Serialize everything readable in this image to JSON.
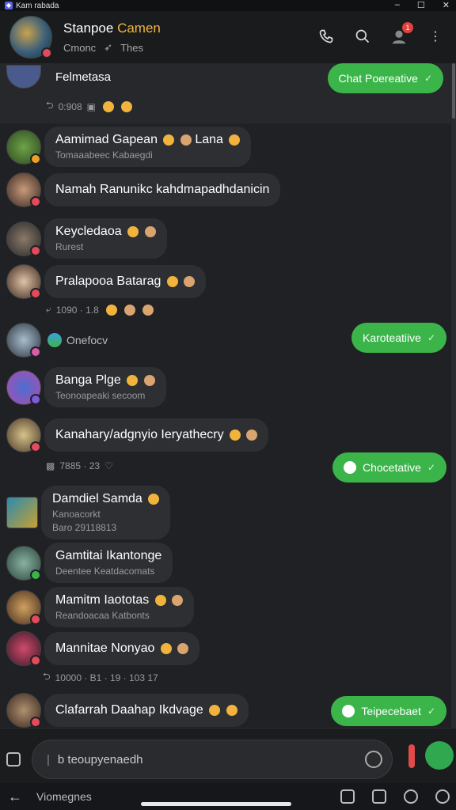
{
  "window": {
    "title": "Kam rabada",
    "controls": [
      "–",
      "☐",
      "✕"
    ]
  },
  "header": {
    "name": "Stanpoe",
    "name_accent": "Camen",
    "subtitle_left": "Cmonc",
    "subtitle_right": "Thes",
    "notification_count": "1"
  },
  "pinned": {
    "title": "Felmetasa",
    "meta": "0:908",
    "out_text": "Chat Poereative"
  },
  "messages": [
    {
      "title": "Aamimad Gapean",
      "extra": "Lana",
      "sub": "Tomaaabeec Kabaegdi"
    },
    {
      "title": "Namah Ranunikc kahdmapadhdanicin",
      "sub": ""
    },
    {
      "title": "Keycledaoa",
      "sub": "Rurest"
    },
    {
      "title": "Pralapooa Batarag",
      "sub": ""
    },
    {
      "title": "Banga Plge",
      "sub": "Teonoapeaki secoom"
    },
    {
      "title": "Kanahary/adgnyio Ieryathecry",
      "sub": ""
    },
    {
      "title": "Damdiel Samda",
      "sub": "Kanoacorkt",
      "sub2": "Baro 29118813"
    },
    {
      "title": "Gamtitai Ikantonge",
      "sub": "Deentee Keatdacomats"
    },
    {
      "title": "Mamitm Iaototas",
      "sub": "Reandoacaa Katbonts"
    },
    {
      "title": "Mannitae Nonyao",
      "sub": ""
    },
    {
      "title": "Clafarrah Daahap Ikdvage",
      "sub": ""
    }
  ],
  "meta_rows": {
    "row1": "1090 · 1.8",
    "status_name": "Onefocv",
    "row2": "7885 · 23",
    "row3": "10000 · B1 · 19 · 103 17"
  },
  "outgoing": [
    {
      "text": "Karoteatiive"
    },
    {
      "text": "Chocetative"
    },
    {
      "text": "Teipecebaet"
    }
  ],
  "composer": {
    "placeholder": "b teoupyenaedh"
  },
  "bottombar": {
    "label": "Viomegnes"
  }
}
